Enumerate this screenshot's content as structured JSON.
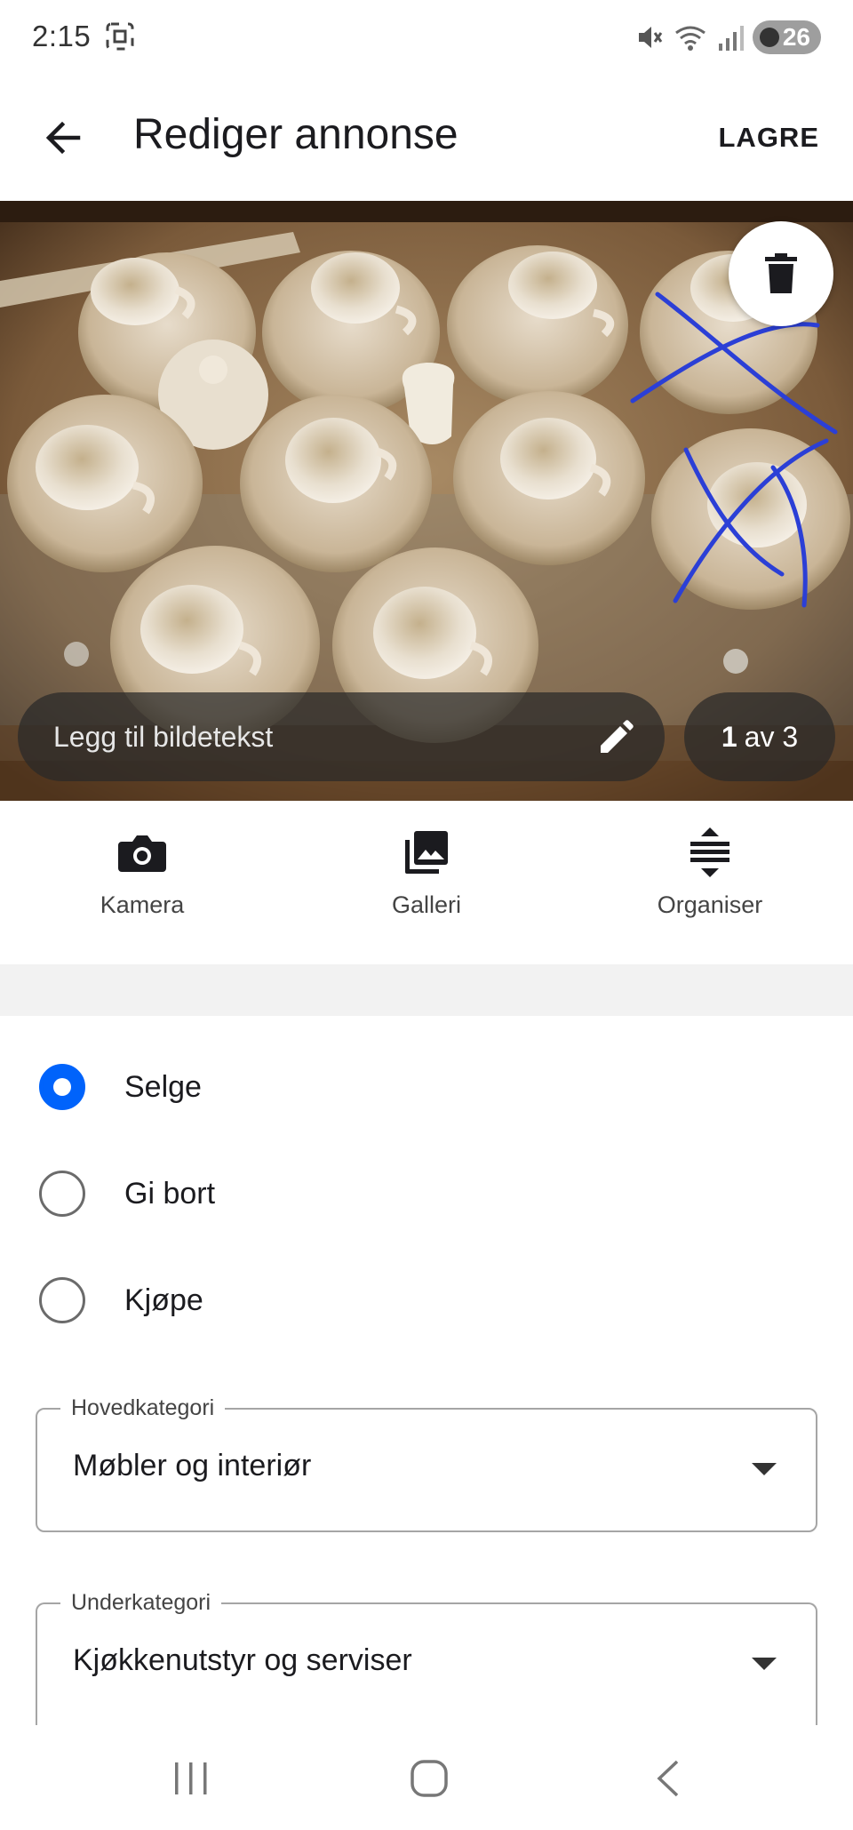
{
  "status_bar": {
    "time": "2:15",
    "battery": "26"
  },
  "app_bar": {
    "title": "Rediger annonse",
    "save_label": "LAGRE"
  },
  "photo": {
    "caption_placeholder": "Legg til bildetekst",
    "counter_current": "1",
    "counter_rest": "av 3"
  },
  "photo_actions": [
    {
      "label": "Kamera",
      "icon": "camera-icon"
    },
    {
      "label": "Galleri",
      "icon": "gallery-icon"
    },
    {
      "label": "Organiser",
      "icon": "reorder-icon"
    }
  ],
  "ad_type": {
    "options": [
      {
        "label": "Selge",
        "selected": true
      },
      {
        "label": "Gi bort",
        "selected": false
      },
      {
        "label": "Kjøpe",
        "selected": false
      }
    ]
  },
  "fields": {
    "main_category": {
      "label": "Hovedkategori",
      "value": "Møbler og interiør"
    },
    "sub_category": {
      "label": "Underkategori",
      "value": "Kjøkkenutstyr og serviser"
    }
  },
  "colors": {
    "accent": "#0063fb",
    "scribble": "#2b3fd6"
  }
}
